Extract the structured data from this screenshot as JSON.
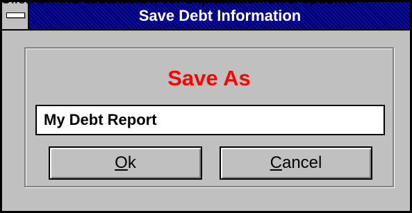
{
  "caption": "Click on the area below for explanation on a specific",
  "window": {
    "title": "Save Debt Information"
  },
  "dialog": {
    "heading": "Save As",
    "filename_value": "My Debt Report"
  },
  "buttons": {
    "ok": {
      "mnemonic": "O",
      "rest": "k"
    },
    "cancel": {
      "mnemonic": "C",
      "rest": "ancel"
    }
  },
  "colors": {
    "heading": "#ff0000",
    "titlebar": "#000080",
    "face": "#c0c0c0"
  },
  "icons": {
    "system_menu": "system-menu-icon"
  }
}
